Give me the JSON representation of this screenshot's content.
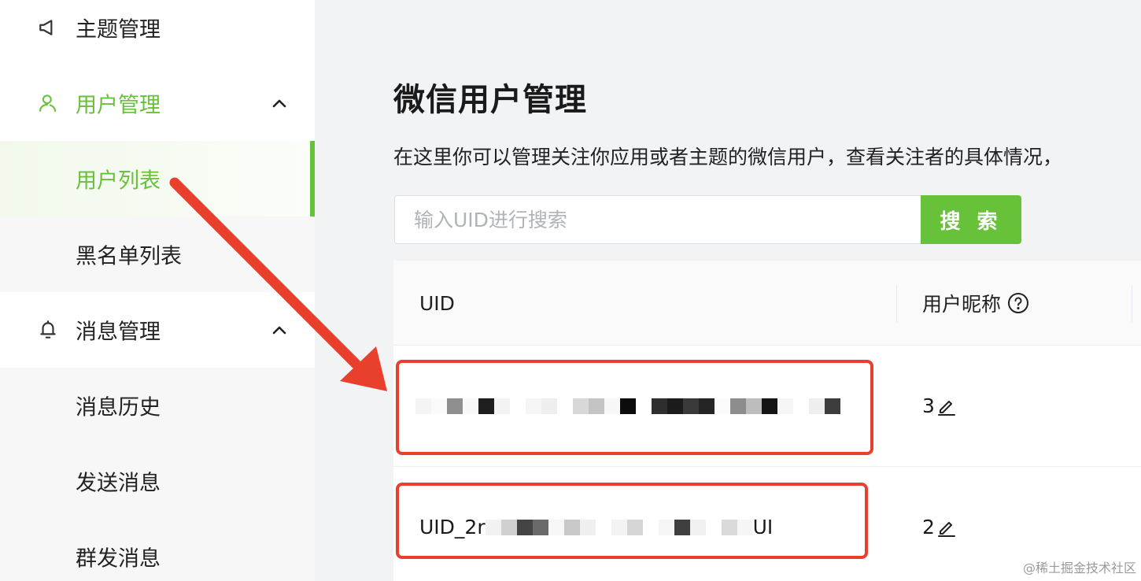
{
  "sidebar": {
    "items": [
      {
        "label": "主题管理",
        "icon": "megaphone-icon"
      },
      {
        "label": "用户管理",
        "icon": "user-icon",
        "expanded": true
      },
      {
        "label": "用户列表",
        "active": true
      },
      {
        "label": "黑名单列表"
      },
      {
        "label": "消息管理",
        "icon": "bell-icon",
        "expanded": true
      },
      {
        "label": "消息历史"
      },
      {
        "label": "发送消息"
      },
      {
        "label": "群发消息"
      }
    ]
  },
  "main": {
    "title": "微信用户管理",
    "description": "在这里你可以管理关注你应用或者主题的微信用户，查看关注者的具体情况，",
    "search": {
      "placeholder": "输入UID进行搜索",
      "button_label": "搜 索"
    },
    "table": {
      "columns": [
        "UID",
        "用户昵称"
      ],
      "rows": [
        {
          "uid_prefix": "",
          "uid_suffix": "",
          "nickname": "3"
        },
        {
          "uid_prefix": "UID_2r",
          "uid_suffix": "UI",
          "nickname": "2"
        }
      ]
    }
  },
  "colors": {
    "accent": "#67c23a",
    "annotation": "#e8402c"
  },
  "watermark": "@稀土掘金技术社区"
}
